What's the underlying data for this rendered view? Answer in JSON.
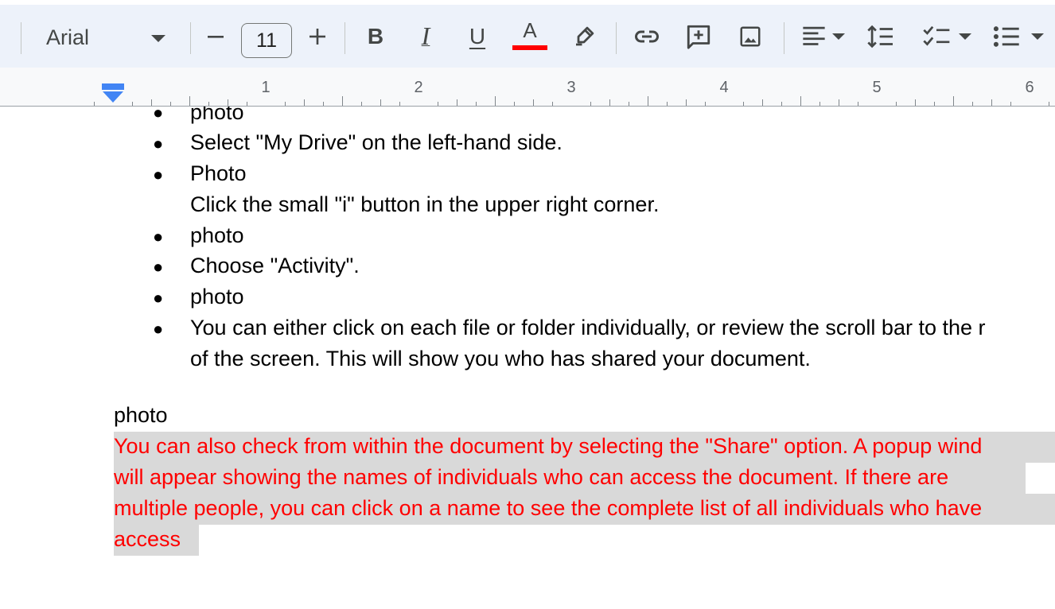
{
  "toolbar": {
    "font_name": "Arial",
    "font_size": "11",
    "text_color_underline": "#ff0000",
    "icons": [
      "font-dropdown-icon",
      "decrease-font-size-icon",
      "increase-font-size-icon",
      "bold-icon",
      "italic-icon",
      "underline-icon",
      "text-color-icon",
      "highlight-icon",
      "insert-link-icon",
      "add-comment-icon",
      "insert-image-icon",
      "align-icon",
      "line-spacing-icon",
      "checklist-icon",
      "bulleted-list-icon"
    ],
    "bold_glyph": "B",
    "italic_glyph": "I",
    "underline_glyph": "U",
    "text_color_glyph": "A"
  },
  "ruler": {
    "numbers": [
      "1",
      "2",
      "3",
      "4",
      "5",
      "6"
    ]
  },
  "document": {
    "bullets": [
      {
        "text": "photo"
      },
      {
        "text": "Select \"My Drive\" on the left-hand side."
      },
      {
        "text": "Photo",
        "continuation": "Click the small \"i\" button in the upper right corner."
      },
      {
        "text": "photo"
      },
      {
        "text": "Choose \"Activity\"."
      },
      {
        "text": "photo"
      },
      {
        "text": "You can either click on each file or folder individually, or review the scroll bar to the r",
        "continuation": "of the screen. This will show you who has shared your document."
      }
    ],
    "paragraph_photo": "photo",
    "highlighted_lines": [
      "You can also check from within the document by selecting the \"Share\" option. A popup wind",
      "will appear showing the names of individuals who can access the document. If there are",
      "multiple people, you can click on a name to see the complete list of all individuals who have",
      "access"
    ],
    "highlight_color": "#d9d9d9",
    "highlight_text_color": "#ff0000"
  }
}
